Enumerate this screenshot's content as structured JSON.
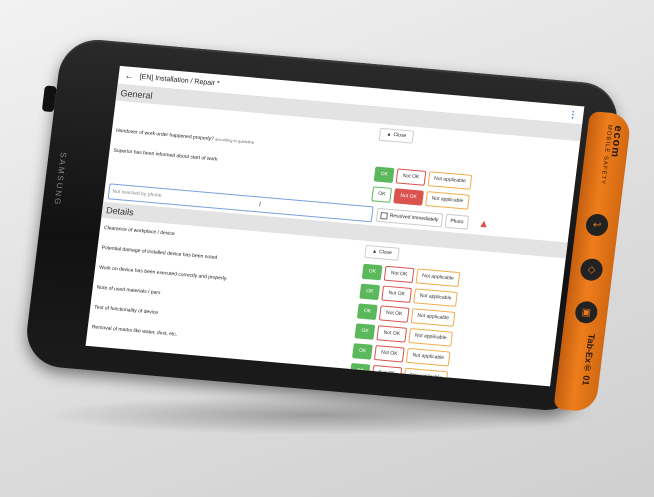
{
  "app": {
    "title": "[EN] Installation / Repair *"
  },
  "device": {
    "brand": "ecom",
    "brand_sub": "MOBILE SAFETY",
    "manufacturer": "SAMSUNG",
    "model": "Tab-Ex® 01"
  },
  "labels": {
    "close": "Close",
    "ok": "OK",
    "not_ok": "Not OK",
    "not_applicable": "Not applicable",
    "resolved": "Resolved immediately",
    "photo": "Photo"
  },
  "general": {
    "title": "General",
    "q1": "Handover of work order happened properly?",
    "q1_hint": "according to guideline",
    "q2": "Superior has been informed about start of work",
    "note_placeholder": "Not reached by phone"
  },
  "details": {
    "title": "Details",
    "items": [
      {
        "label": "Clearance of workplace / device"
      },
      {
        "label": "Potential damage of installed device has been noted"
      },
      {
        "label": "Work on device has been executed correctly and properly."
      },
      {
        "label": "Note of used materials / pars"
      },
      {
        "label": "Test of functionality of device"
      },
      {
        "label": "Removal of marks like water, dust, etc."
      }
    ]
  },
  "colors": {
    "ok": "#5cb85c",
    "not_ok": "#d9534f",
    "not_applicable": "#f0ad4e",
    "accent": "#ef7d1c"
  }
}
